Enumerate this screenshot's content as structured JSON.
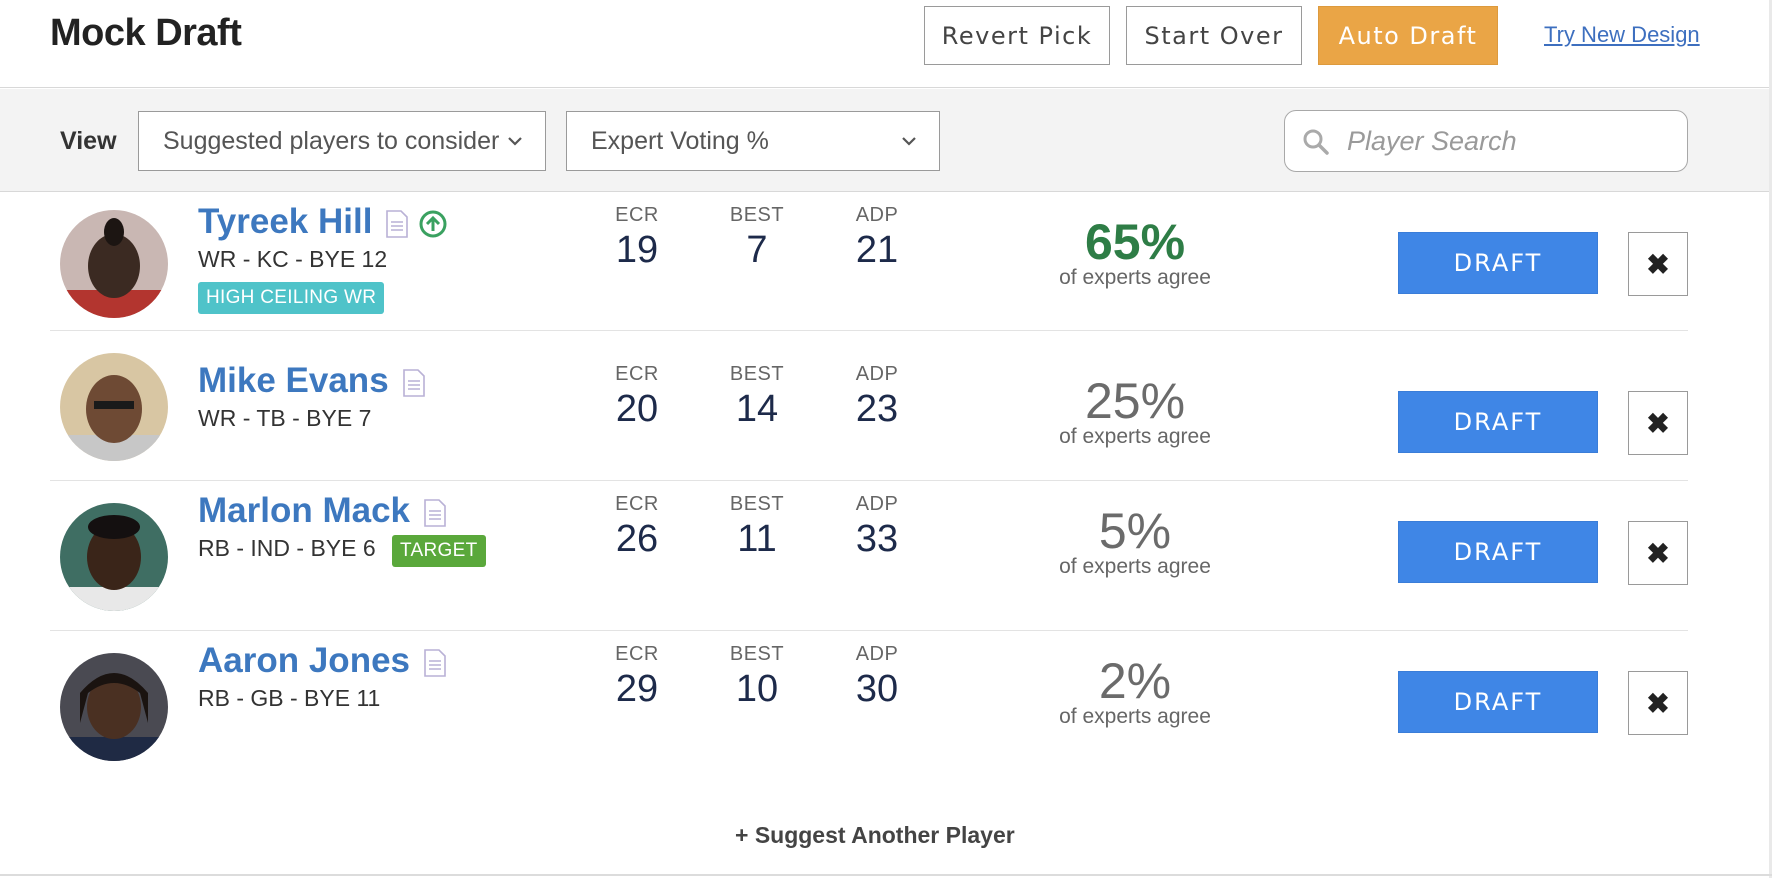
{
  "header": {
    "title": "Mock Draft",
    "revert_label": "Revert Pick",
    "start_over_label": "Start Over",
    "auto_draft_label": "Auto Draft",
    "try_new_label": "Try New Design"
  },
  "filters": {
    "view_label": "View",
    "view_select": "Suggested players to consider",
    "sort_select": "Expert Voting %",
    "search_placeholder": "Player Search"
  },
  "columns": {
    "ecr": "ECR",
    "best": "BEST",
    "adp": "ADP"
  },
  "agree_suffix": "of experts agree",
  "draft_label": "DRAFT",
  "dismiss_label": "✖",
  "players": [
    {
      "name": "Tyreek Hill",
      "info": "WR - KC - BYE 12",
      "tag": "HIGH CEILING WR",
      "ecr": "19",
      "best": "7",
      "adp": "21",
      "pct": "65%"
    },
    {
      "name": "Mike Evans",
      "info": "WR - TB - BYE 7",
      "tag": "",
      "ecr": "20",
      "best": "14",
      "adp": "23",
      "pct": "25%"
    },
    {
      "name": "Marlon Mack",
      "info": "RB - IND - BYE 6",
      "tag": "TARGET",
      "ecr": "26",
      "best": "11",
      "adp": "33",
      "pct": "5%"
    },
    {
      "name": "Aaron Jones",
      "info": "RB - GB - BYE 11",
      "tag": "",
      "ecr": "29",
      "best": "10",
      "adp": "30",
      "pct": "2%"
    }
  ],
  "suggest_label": "+ Suggest Another Player",
  "colors": {
    "draft": "#3f86e6",
    "auto_draft": "#eaa546",
    "name": "#3d78bf",
    "top_pct": "#2e7d46"
  }
}
